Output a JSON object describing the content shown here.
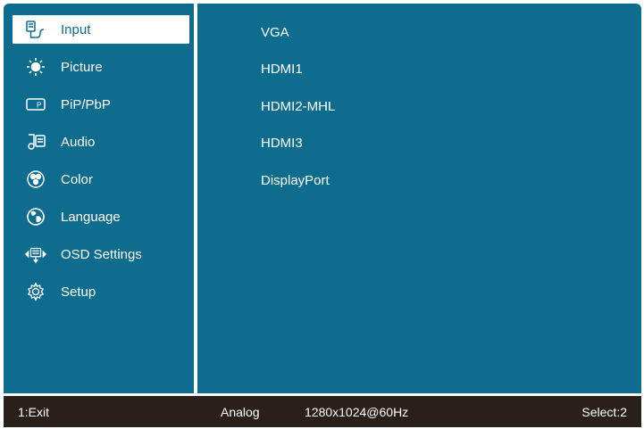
{
  "menu": {
    "items": [
      {
        "label": "Input",
        "icon": "input-icon",
        "selected": true
      },
      {
        "label": "Picture",
        "icon": "brightness-icon"
      },
      {
        "label": "PiP/PbP",
        "icon": "pip-icon"
      },
      {
        "label": "Audio",
        "icon": "audio-icon"
      },
      {
        "label": "Color",
        "icon": "color-palette-icon"
      },
      {
        "label": "Language",
        "icon": "globe-icon"
      },
      {
        "label": "OSD Settings",
        "icon": "osd-settings-icon"
      },
      {
        "label": "Setup",
        "icon": "gear-icon"
      }
    ]
  },
  "input_options": [
    "VGA",
    "HDMI1",
    "HDMI2-MHL",
    "HDMI3",
    "DisplayPort"
  ],
  "status": {
    "exit": "1:Exit",
    "signal": "Analog",
    "resolution": "1280x1024@60Hz",
    "select": "Select:2"
  },
  "colors": {
    "panel": "#0e6d8f",
    "statusbar": "#2a1f1a",
    "highlight": "#ffffff"
  }
}
